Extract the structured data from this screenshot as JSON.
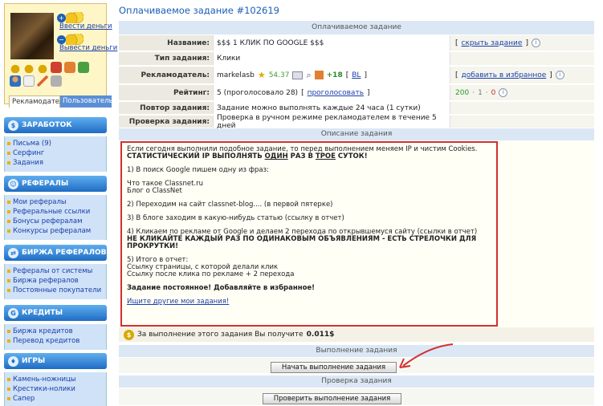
{
  "sidebar": {
    "wallet": {
      "deposit_label": "Ввести деньги",
      "withdraw_label": "Вывести деньги",
      "deposit_glyph": "+",
      "withdraw_glyph": "−"
    },
    "user_tabs": {
      "advertiser": "Рекламодатель",
      "user": "Пользователь"
    },
    "sections": [
      {
        "title": "ЗАРАБОТОК",
        "glyph": "$",
        "items": [
          "Письма (9)",
          "Серфинг",
          "Задания"
        ]
      },
      {
        "title": "РЕФЕРАЛЫ",
        "glyph": "☺",
        "items": [
          "Мои рефералы",
          "Реферальные ссылки",
          "Бонусы рефералам",
          "Конкурсы рефералам"
        ]
      },
      {
        "title": "БИРЖА РЕФЕРАЛОВ",
        "glyph": "⇄",
        "items": [
          "Рефералы от системы",
          "Биржа рефералов",
          "Постоянные покупатели"
        ]
      },
      {
        "title": "КРЕДИТЫ",
        "glyph": "G",
        "items": [
          "Биржа кредитов",
          "Перевод кредитов"
        ]
      },
      {
        "title": "ИГРЫ",
        "glyph": "♦",
        "items": [
          "Камень-ножницы",
          "Крестики-нолики",
          "Сапер"
        ]
      }
    ]
  },
  "page": {
    "title": "Оплачиваемое задание #102619",
    "section_paid": "Оплачиваемое задание",
    "section_description": "Описание задания",
    "section_execution": "Выполнение задания",
    "section_check": "Проверка задания"
  },
  "task": {
    "name_label": "Название:",
    "name_value": "$$$ 1 КЛИК ПО GOOGLE $$$",
    "hide_link": "скрыть задание",
    "type_label": "Тип задания:",
    "type_value": "Клики",
    "advertiser_label": "Рекламодатель:",
    "advertiser_name": "markelasb",
    "advertiser_rating": "54.37",
    "advertiser_plus": "+18",
    "advertiser_bl": "BL",
    "favorite_link": "добавить в избранное",
    "rating_label": "Рейтинг:",
    "rating_value": "5 (проголосовало 28)",
    "vote_link": "проголосовать",
    "votes": {
      "positive": "200",
      "sep1": "·",
      "neutral": "1",
      "sep2": "·",
      "negative": "0"
    },
    "repeat_label": "Повтор задания:",
    "repeat_value": "Задание можно выполнять каждые 24 часа (1 сутки)",
    "check_label": "Проверка задания:",
    "check_value": "Проверка в ручном режиме рекламодателем в течение 5 дней"
  },
  "description": {
    "intro": "Если сегодня выполнили подобное задание, то перед выполнением меняем IP и чистим Cookies.",
    "warn_a": "СТАТИСТИЧЕСКИЙ IP ВЫПОЛНЯТЬ ",
    "warn_once": "ОДИН",
    "warn_b": " РАЗ В ",
    "warn_three": "ТРОЕ",
    "warn_c": " СУТОК!",
    "step1": "1) В поиск Google пишем одну из фраз:",
    "phrase1": "Что такое Classnet.ru",
    "phrase2": "Блог о ClassNet",
    "step2": "2) Переходим на сайт classnet-blog.... (в первой пятерке)",
    "step3": "3) В блоге заходим в какую-нибудь статью (ссылку в отчет)",
    "step4": "4) Кликаем по рекламе от Google и делаем 2 перехода по открывшемуся сайту (ссылки в отчет)",
    "step4_warn": "НЕ КЛИКАЙТЕ КАЖДЫЙ РАЗ ПО ОДИНАКОВЫМ ОБЪЯВЛЕНИЯМ - ЕСТЬ СТРЕЛОЧКИ ДЛЯ ПРОКРУТКИ!",
    "step5": "5) Итого в отчет:",
    "report1": "Ссылку страницы, с которой делали клик",
    "report2": "Ссылку после клика по рекламе + 2 перехода",
    "permanent": "Задание постоянное! Добавляйте в избранное!",
    "other_link": "Ищите другие мои задания!"
  },
  "reward": {
    "prefix": "За выполнение этого задания Вы получите",
    "amount": "0.011$",
    "coin_glyph": "$"
  },
  "buttons": {
    "start": "Начать выполнение задания",
    "check": "Проверить выполнение задания"
  },
  "colors": {
    "accent": "#1a5eb8",
    "highlight_border": "#d23030",
    "arrow": "#d23030"
  }
}
